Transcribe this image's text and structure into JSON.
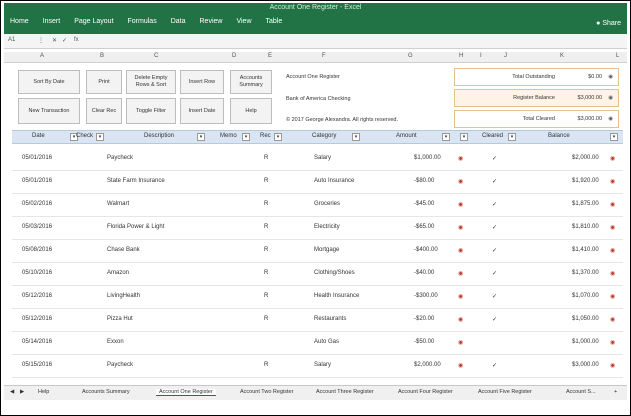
{
  "ribbon": {
    "title": "Account One Register - Excel",
    "tabs": [
      "Home",
      "Insert",
      "Page Layout",
      "Formulas",
      "Data",
      "Review",
      "View",
      "Table"
    ],
    "share": "Share",
    "bg_color": "#217346"
  },
  "formula_bar": {
    "name_box": "A1",
    "fx": "fx"
  },
  "columns": [
    "A",
    "B",
    "C",
    "D",
    "E",
    "F",
    "G",
    "H",
    "I",
    "J",
    "K",
    "L"
  ],
  "buttons": {
    "sort_by_date": "Sort By Date",
    "print": "Print",
    "delete_empty": "Delete Empty Rows & Sort",
    "insert_row": "Insert Row",
    "accounts_summary": "Accounts Summary",
    "new_transaction": "New Transaction",
    "clear_rec": "Clear Rec",
    "toggle_filter": "Toggle Filter",
    "insert_date": "Insert Date",
    "help": "Help"
  },
  "info": {
    "register_name": "Account One Register",
    "bank_name": "Bank of America Checking",
    "copyright": "© 2017 George Alexandra. All rights reserved."
  },
  "summary": {
    "rows": [
      {
        "label": "Total Outstanding",
        "value": "$0.00"
      },
      {
        "label": "Register Balance",
        "value": "$3,000.00"
      },
      {
        "label": "Total Cleared",
        "value": "$3,000.00"
      }
    ]
  },
  "headers": [
    "Date",
    "Check",
    "Description",
    "Memo",
    "Rec",
    "Category",
    "Amount",
    "Cleared",
    "Balance"
  ],
  "rows": [
    {
      "date": "05/01/2016",
      "check": "",
      "description": "Paycheck",
      "rec": "R",
      "category": "Salary",
      "amount": "$1,000.00",
      "cleared": "✓",
      "balance": "$2,000.00"
    },
    {
      "date": "05/01/2016",
      "check": "",
      "description": "State Farm Insurance",
      "rec": "R",
      "category": "Auto Insurance",
      "amount": "-$80.00",
      "cleared": "✓",
      "balance": "$1,920.00"
    },
    {
      "date": "05/02/2016",
      "check": "",
      "description": "Walmart",
      "rec": "R",
      "category": "Groceries",
      "amount": "-$45.00",
      "cleared": "✓",
      "balance": "$1,875.00"
    },
    {
      "date": "05/03/2016",
      "check": "",
      "description": "Florida Power & Light",
      "rec": "R",
      "category": "Electricity",
      "amount": "-$65.00",
      "cleared": "✓",
      "balance": "$1,810.00"
    },
    {
      "date": "05/08/2016",
      "check": "",
      "description": "Chase Bank",
      "rec": "R",
      "category": "Mortgage",
      "amount": "-$400.00",
      "cleared": "✓",
      "balance": "$1,410.00"
    },
    {
      "date": "05/10/2016",
      "check": "",
      "description": "Amazon",
      "rec": "R",
      "category": "Clothing/Shoes",
      "amount": "-$40.00",
      "cleared": "✓",
      "balance": "$1,370.00"
    },
    {
      "date": "05/12/2016",
      "check": "",
      "description": "LivingHealth",
      "rec": "R",
      "category": "Health Insurance",
      "amount": "-$300.00",
      "cleared": "✓",
      "balance": "$1,070.00"
    },
    {
      "date": "05/12/2016",
      "check": "",
      "description": "Pizza Hut",
      "rec": "R",
      "category": "Restaurants",
      "amount": "-$20.00",
      "cleared": "✓",
      "balance": "$1,050.00"
    },
    {
      "date": "05/14/2016",
      "check": "",
      "description": "Exxon",
      "rec": "",
      "category": "Auto Gas",
      "amount": "-$50.00",
      "cleared": "",
      "balance": "$1,000.00"
    },
    {
      "date": "05/15/2016",
      "check": "",
      "description": "Paycheck",
      "rec": "R",
      "category": "Salary",
      "amount": "$2,000.00",
      "cleared": "✓",
      "balance": "$3,000.00"
    }
  ],
  "sheets": [
    "Help",
    "Accounts Summary",
    "Account One Register",
    "Account Two Register",
    "Account Three Register",
    "Account Four Register",
    "Account Five Register",
    "Account S..."
  ],
  "active_sheet": 2
}
